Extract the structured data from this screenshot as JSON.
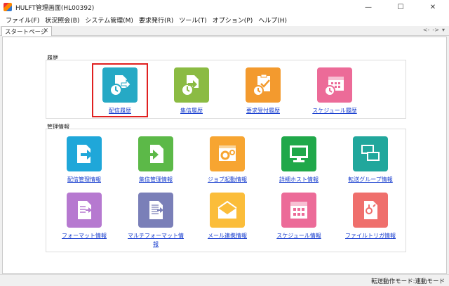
{
  "window": {
    "title": "HULFT管理画面(HL00392)",
    "controls": {
      "minimize": "—",
      "maximize": "☐",
      "close": "✕"
    }
  },
  "menu": [
    "ファイル(F)",
    "状況照会(B)",
    "システム管理(M)",
    "要求発行(R)",
    "ツール(T)",
    "オプション(P)",
    "ヘルプ(H)"
  ],
  "tab": {
    "label": "スタートページ",
    "close": "✕"
  },
  "tab_nav": {
    "back": "<-",
    "forward": "->",
    "menu": "▾"
  },
  "sections": {
    "history": {
      "label": "履歴"
    },
    "management": {
      "label": "管理情報"
    }
  },
  "history_tiles": [
    {
      "label": "配信履歴",
      "color": "#26a9c5",
      "icon": "send-history-icon"
    },
    {
      "label": "集信履歴",
      "color": "#8bbb43",
      "icon": "receive-history-icon"
    },
    {
      "label": "要求受付履歴",
      "color": "#f39a2e",
      "icon": "request-history-icon"
    },
    {
      "label": "スケジュール履歴",
      "color": "#ec6b98",
      "icon": "schedule-history-icon"
    }
  ],
  "management_tiles": [
    {
      "label": "配信管理情報",
      "color": "#1fa7d9",
      "icon": "send-management-icon"
    },
    {
      "label": "集信管理情報",
      "color": "#5cb948",
      "icon": "receive-management-icon"
    },
    {
      "label": "ジョブ起動情報",
      "color": "#f7a531",
      "icon": "job-start-icon"
    },
    {
      "label": "詳細ホスト情報",
      "color": "#20a84a",
      "icon": "host-detail-icon"
    },
    {
      "label": "転送グループ情報",
      "color": "#21a79c",
      "icon": "transfer-group-icon"
    },
    {
      "label": "フォーマット情報",
      "color": "#b679d0",
      "icon": "format-icon"
    },
    {
      "label": "マルチフォーマット情報",
      "color": "#7a7fb8",
      "icon": "multi-format-icon"
    },
    {
      "label": "メール連携情報",
      "color": "#fbbd3a",
      "icon": "mail-link-icon"
    },
    {
      "label": "スケジュール情報",
      "color": "#ec6b98",
      "icon": "schedule-icon"
    },
    {
      "label": "ファイルトリガ情報",
      "color": "#ef6f6c",
      "icon": "file-trigger-icon"
    }
  ],
  "statusbar": {
    "text": "転送動作モード:連動モード"
  }
}
